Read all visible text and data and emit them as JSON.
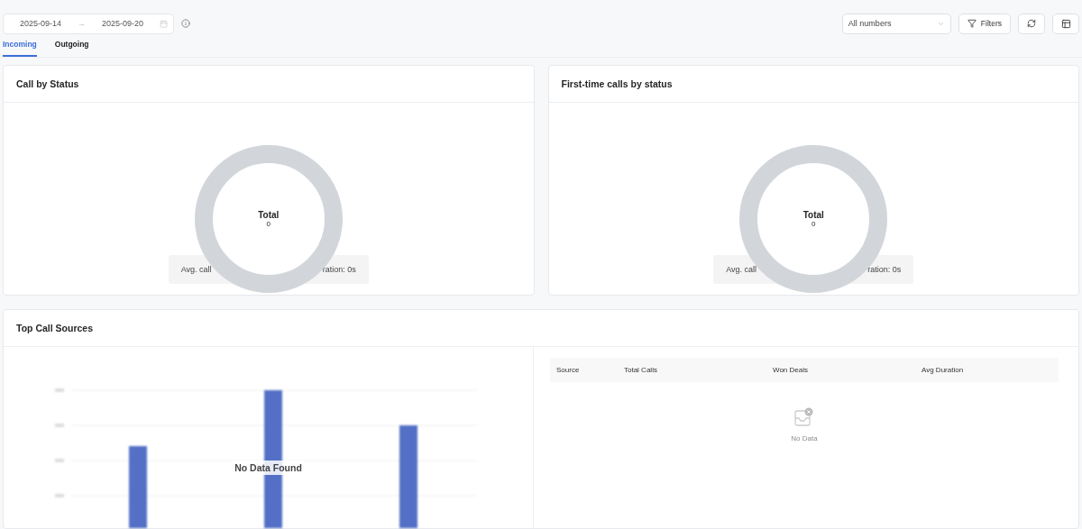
{
  "toolbar": {
    "date_start": "2025-09-14",
    "date_separator": "→",
    "date_end": "2025-09-20",
    "number_select": {
      "value": "All numbers"
    },
    "filters_button": "Filters"
  },
  "tabs": [
    {
      "label": "Incoming",
      "selected": true
    },
    {
      "label": "Outgoing",
      "selected": false
    }
  ],
  "status_cards": [
    {
      "title": "Call by Status",
      "total_label": "Total",
      "total_value": "0",
      "stat_left": "Avg. call",
      "stat_right": "ration: 0s"
    },
    {
      "title": "First-time calls by status",
      "total_label": "Total",
      "total_value": "0",
      "stat_left": "Avg. call",
      "stat_right": "ration: 0s"
    }
  ],
  "sources_card": {
    "title": "Top Call Sources",
    "chart_overlay": "No Data Found",
    "table": {
      "columns": [
        "Source",
        "Total Calls",
        "Won Deals",
        "Avg Duration"
      ],
      "empty_text": "No Data"
    }
  }
}
